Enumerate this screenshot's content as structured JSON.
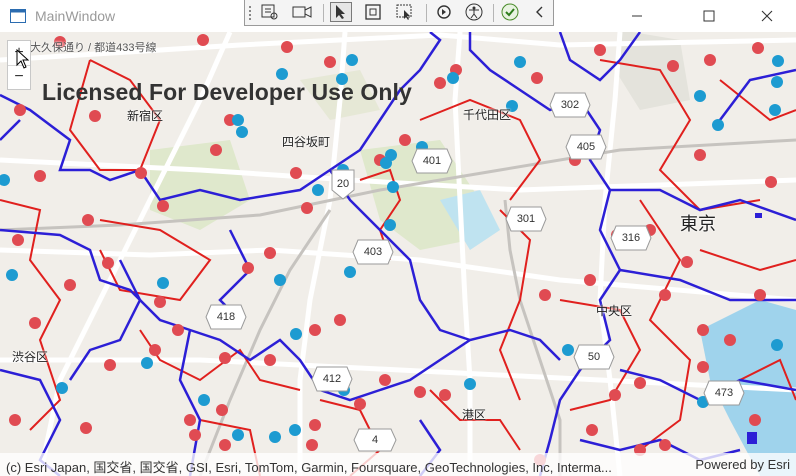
{
  "window": {
    "title": "MainWindow"
  },
  "toolbar": {
    "icons": [
      "live-visual-tree-icon",
      "display-layout-adorners-icon",
      "select-element-icon",
      "element-highlight-icon",
      "preview-selection-icon",
      "hot-reload-icon",
      "accessibility-scanner-icon",
      "track-focus-icon",
      "collapse-toolbar-icon"
    ]
  },
  "zoom": {
    "in_label": "+",
    "out_label": "−"
  },
  "watermark": "Licensed For Developer Use Only",
  "place_labels": {
    "shinjuku": "新宿区",
    "yotsuya": "四谷坂町",
    "chiyoda": "千代田区",
    "tokyo": "東京",
    "chuo": "中央区",
    "shibuya": "渋谷区",
    "minato": "港区",
    "top_road": "大久保通り / 都道433号線"
  },
  "route_shields": [
    "302",
    "405",
    "401",
    "20",
    "301",
    "316",
    "403",
    "418",
    "50",
    "412",
    "473",
    "4"
  ],
  "attribution": {
    "text": "(c) Esri Japan, 国交省, 国交省, GSI, Esri, TomTom, Garmin, Foursquare, GeoTechnologies, Inc, Interma...",
    "powered_by": "Powered by Esri"
  },
  "colors": {
    "boundary_major": "#2c1fd6",
    "boundary_minor": "#e0201e",
    "point_red": "#e04b52",
    "point_blue": "#1d9bd1"
  }
}
